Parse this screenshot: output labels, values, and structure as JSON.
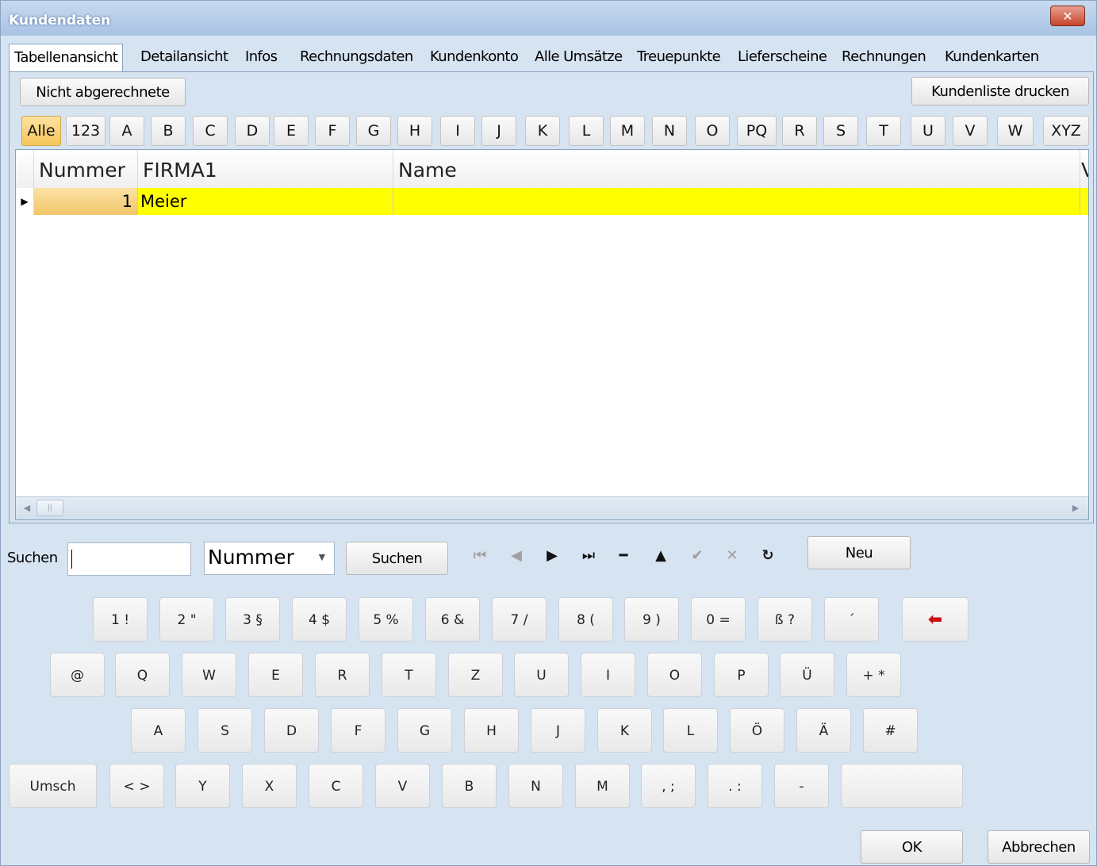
{
  "window": {
    "title": "Kundendaten",
    "close_glyph": "✕"
  },
  "tabs": [
    "Tabellenansicht",
    "Detailansicht",
    "Infos",
    "Rechnungsdaten",
    "Kundenkonto",
    "Alle Umsätze",
    "Treuepunkte",
    "Lieferscheine",
    "Rechnungen",
    "Kundenkarten"
  ],
  "toolbar": {
    "unbilled_button": "Nicht abgerechnete",
    "print_button": "Kundenliste drucken"
  },
  "letters": [
    "Alle",
    "123",
    "A",
    "B",
    "C",
    "D",
    "E",
    "F",
    "G",
    "H",
    "I",
    "J",
    "K",
    "L",
    "M",
    "N",
    "O",
    "PQ",
    "R",
    "S",
    "T",
    "U",
    "V",
    "W",
    "XYZ"
  ],
  "grid": {
    "columns": [
      "Nummer",
      "FIRMA1",
      "Name",
      "V"
    ],
    "rows": [
      {
        "nummer": "1",
        "firma1": "Meier",
        "name": ""
      }
    ],
    "highlight_color": "#ffff00"
  },
  "search": {
    "label": "Suchen",
    "value": "",
    "field_select": "Nummer",
    "button": "Suchen",
    "new_button": "Neu"
  },
  "navigator": [
    "first-icon",
    "prior-icon",
    "next-icon",
    "last-icon",
    "delete-icon",
    "edit-icon",
    "post-icon",
    "cancel-icon",
    "refresh-icon"
  ],
  "keyboard": {
    "row1": [
      "1 !",
      "2 \"",
      "3 §",
      "4 $",
      "5 %",
      "6 &",
      "7 /",
      "8 (",
      "9 )",
      "0 =",
      "ß ?",
      "´"
    ],
    "backspace": "backspace-arrow-icon",
    "row2": [
      "@",
      "Q",
      "W",
      "E",
      "R",
      "T",
      "Z",
      "U",
      "I",
      "O",
      "P",
      "Ü",
      "+ *"
    ],
    "row3": [
      "A",
      "S",
      "D",
      "F",
      "G",
      "H",
      "J",
      "K",
      "L",
      "Ö",
      "Ä",
      "#"
    ],
    "shift": "Umsch",
    "row4": [
      "< >",
      "Y",
      "X",
      "C",
      "V",
      "B",
      "N",
      "M",
      ", ;",
      ". :",
      "-"
    ],
    "space": ""
  },
  "footer": {
    "ok": "OK",
    "cancel": "Abbrechen"
  }
}
